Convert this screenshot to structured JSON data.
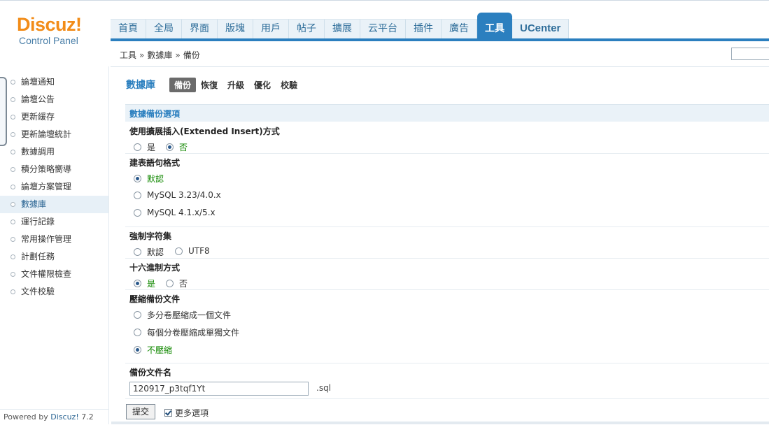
{
  "logo": {
    "brand": "Discuz!",
    "subtitle": "Control Panel"
  },
  "topnav": [
    "首頁",
    "全局",
    "界面",
    "版塊",
    "用戶",
    "帖子",
    "擴展",
    "云平台",
    "插件",
    "廣告",
    "工具",
    "UCenter"
  ],
  "topnav_active": "工具",
  "breadcrumb": {
    "items": [
      "工具",
      "數據庫",
      "備份"
    ],
    "sep": "»"
  },
  "sidebar": {
    "items": [
      "論壇通知",
      "論壇公告",
      "更新緩存",
      "更新論壇統計",
      "數據調用",
      "積分策略嚮導",
      "論壇方案管理",
      "數據庫",
      "運行記錄",
      "常用操作管理",
      "計劃任務",
      "文件權限檢查",
      "文件校驗"
    ],
    "active": "數據庫",
    "powered_prefix": "Powered by",
    "powered_brand": "Discuz!",
    "powered_version": "7.2"
  },
  "main": {
    "title": "數據庫",
    "ops": [
      "備份",
      "恢復",
      "升級",
      "優化",
      "校驗"
    ],
    "active_op": "備份",
    "section_title": "數據備份選項",
    "extended_insert": {
      "label": "使用擴展插入(Extended Insert)方式",
      "options": [
        "是",
        "否"
      ],
      "selected": "否"
    },
    "create_syntax": {
      "label": "建表語句格式",
      "options": [
        "默認",
        "MySQL 3.23/4.0.x",
        "MySQL 4.1.x/5.x"
      ],
      "selected": "默認"
    },
    "charset": {
      "label": "強制字符集",
      "options": [
        "默認",
        "UTF8"
      ],
      "selected": ""
    },
    "hex": {
      "label": "十六進制方式",
      "options": [
        "是",
        "否"
      ],
      "selected": "是"
    },
    "compress": {
      "label": "壓縮備份文件",
      "options": [
        "多分卷壓縮成一個文件",
        "每個分卷壓縮成單獨文件",
        "不壓縮"
      ],
      "selected": "不壓縮"
    },
    "filename": {
      "label": "備份文件名",
      "value": "120917_p3tqf1Yt",
      "ext": ".sql"
    },
    "submit": "提交",
    "more_options": "更多選項",
    "more_checked": true
  }
}
